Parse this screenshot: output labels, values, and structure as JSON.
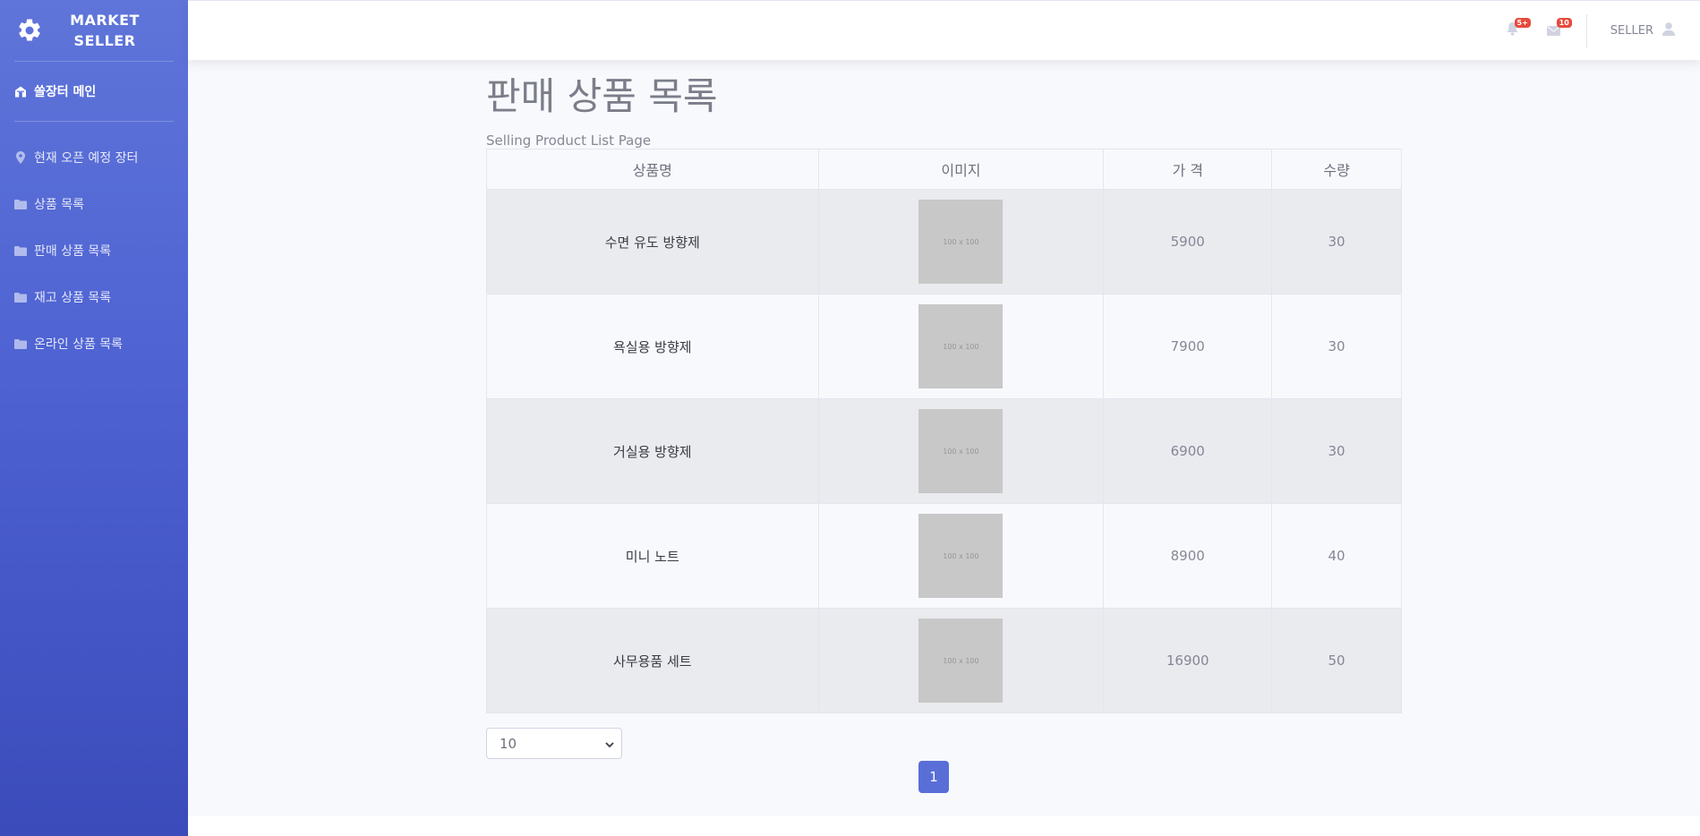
{
  "brand": {
    "line1": "MARKET",
    "line2": "SELLER"
  },
  "sidebar": {
    "main_item": "쏠장터 메인",
    "items": [
      {
        "label": "현재 오픈 예정 장터",
        "icon": "map-marker-icon"
      },
      {
        "label": "상품 목록",
        "icon": "folder-icon"
      },
      {
        "label": "판매 상품 목록",
        "icon": "folder-icon"
      },
      {
        "label": "재고 상품 목록",
        "icon": "folder-icon"
      },
      {
        "label": "온라인 상품 목록",
        "icon": "folder-icon"
      }
    ]
  },
  "topbar": {
    "alerts_badge": "5+",
    "messages_badge": "10",
    "user_name": "SELLER"
  },
  "page": {
    "title": "판매 상품 목록",
    "subtitle": "Selling Product List Page"
  },
  "table": {
    "headers": [
      "상품명",
      "이미지",
      "가 격",
      "수량"
    ],
    "placeholder_text": "100 x 100",
    "rows": [
      {
        "name": "수면 유도 방향제",
        "price": "5900",
        "qty": "30"
      },
      {
        "name": "욕실용 방향제",
        "price": "7900",
        "qty": "30"
      },
      {
        "name": "거실용 방향제",
        "price": "6900",
        "qty": "30"
      },
      {
        "name": "미니 노트",
        "price": "8900",
        "qty": "40"
      },
      {
        "name": "사무용품 세트",
        "price": "16900",
        "qty": "50"
      }
    ]
  },
  "page_size": {
    "selected": "10"
  },
  "pagination": {
    "current": "1"
  },
  "colors": {
    "sidebar_top": "#5f75d9",
    "sidebar_bottom": "#3b4bba",
    "badge": "#e74a3b",
    "active_page": "#5a6ed8"
  }
}
